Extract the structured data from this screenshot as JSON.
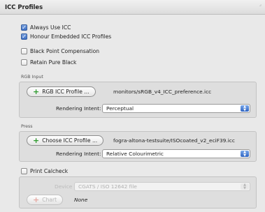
{
  "window": {
    "title": "ICC Profiles"
  },
  "general": {
    "always_use_icc": {
      "label": "Always Use ICC",
      "checked": true
    },
    "honour_embedded": {
      "label": "Honour Embedded ICC Profiles",
      "checked": true
    },
    "black_point": {
      "label": "Black Point Compensation",
      "checked": false
    },
    "retain_black": {
      "label": "Retain Pure Black",
      "checked": false
    }
  },
  "rgb_input": {
    "group_label": "RGB Input",
    "button_label": "RGB ICC Profile ...",
    "path": "monitors/sRGB_v4_ICC_preference.icc",
    "intent_label": "Rendering Intent:",
    "intent_value": "Perceptual"
  },
  "press": {
    "group_label": "Press",
    "button_label": "Choose ICC Profile ...",
    "path": "fogra-altona-testsuite/ISOcoated_v2_eciF39.icc",
    "intent_label": "Rendering Intent:",
    "intent_value": "Relative Colourimetric"
  },
  "calcheck": {
    "label": "Print Calcheck",
    "checked": false,
    "device_label": "Device",
    "device_value": "CGATS / ISO 12642 file",
    "chart_button": "Chart",
    "chart_value": "None"
  },
  "colors": {
    "accent": "#3e6fc4",
    "plus_green": "#2c9a2c"
  }
}
